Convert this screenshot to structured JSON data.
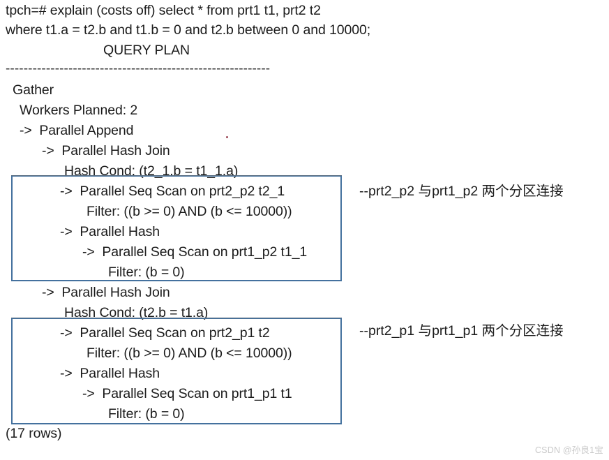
{
  "terminal": {
    "prompt_lines": [
      "tpch=# explain (costs off) select * from prt1 t1, prt2 t2",
      "where t1.a = t2.b and t1.b = 0 and t2.b between 0 and 10000;"
    ],
    "plan_header": "QUERY PLAN",
    "separator": "-----------------------------------------------------------",
    "footer": "(17 rows)"
  },
  "plan_lines": {
    "l1": "Gather",
    "l2": "Workers Planned: 2",
    "l3": "->  Parallel Append",
    "l4": "->  Parallel Hash Join",
    "l5": "Hash Cond: (t2_1.b = t1_1.a)",
    "l6": "->  Parallel Seq Scan on prt2_p2 t2_1",
    "l7": "Filter: ((b >= 0) AND (b <= 10000))",
    "l8": "->  Parallel Hash",
    "l9": "->  Parallel Seq Scan on prt1_p2 t1_1",
    "l10": "Filter: (b = 0)",
    "l11": "->  Parallel Hash Join",
    "l12": "Hash Cond: (t2.b = t1.a)",
    "l13": "->  Parallel Seq Scan on prt2_p1 t2",
    "l14": "Filter: ((b >= 0) AND (b <= 10000))",
    "l15": "->  Parallel Hash",
    "l16": "->  Parallel Seq Scan on prt1_p1 t1",
    "l17": "Filter: (b = 0)"
  },
  "annotations": {
    "first": {
      "prefix": "--prt2_p2 ",
      "cjk_1": "与",
      "mid": "prt1_p2 ",
      "cjk_2": "两个分区连接"
    },
    "second": {
      "prefix": "--prt2_p1 ",
      "cjk_1": "与",
      "mid": "prt1_p1 ",
      "cjk_2": "两个分区连接"
    }
  },
  "highlight_boxes": {
    "box1_label": "parallel-hash-join-partition-p2",
    "box2_label": "parallel-hash-join-partition-p1",
    "border_color": "#44719e"
  },
  "watermark": {
    "text": "CSDN @孙良1宝"
  }
}
